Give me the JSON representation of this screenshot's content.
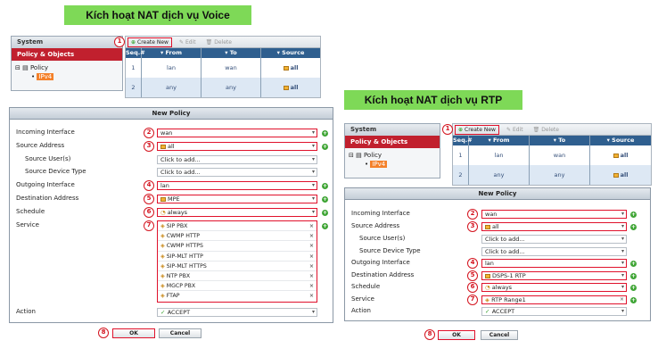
{
  "left": {
    "title": "Kích hoạt NAT dịch vụ Voice",
    "sidebar": {
      "header": "System",
      "active": "Policy & Objects",
      "tree_root": "Policy",
      "tree_child": "IPv4"
    },
    "toolbar": {
      "create": "Create New",
      "edit": "Edit",
      "delete": "Delete"
    },
    "grid": {
      "headers": [
        "Seq.#",
        "From",
        "To",
        "Source"
      ],
      "rows": [
        [
          "1",
          "lan",
          "wan",
          "all"
        ],
        [
          "2",
          "any",
          "any",
          "all"
        ]
      ]
    },
    "form": {
      "title": "New Policy",
      "labels": {
        "incoming": "Incoming Interface",
        "source": "Source Address",
        "users": "Source User(s)",
        "device": "Source Device Type",
        "outgoing": "Outgoing Interface",
        "destination": "Destination Address",
        "schedule": "Schedule",
        "service": "Service",
        "action": "Action"
      },
      "values": {
        "incoming": "wan",
        "source": "all",
        "users": "Click to add...",
        "device": "Click to add...",
        "outgoing": "lan",
        "destination": "MPE",
        "schedule": "always",
        "action": "ACCEPT"
      },
      "services": [
        "SIP PBX",
        "CWMP HTTP",
        "CWMP HTTPS",
        "SIP-MLT HTTP",
        "SIP-MLT HTTPS",
        "NTP PBX",
        "MGCP PBX",
        "FTAP"
      ],
      "ok": "OK",
      "cancel": "Cancel"
    }
  },
  "right": {
    "title": "Kích hoạt NAT dịch vụ RTP",
    "sidebar": {
      "header": "System",
      "active": "Policy & Objects",
      "tree_root": "Policy",
      "tree_child": "IPv4"
    },
    "toolbar": {
      "create": "Create New",
      "edit": "Edit",
      "delete": "Delete"
    },
    "grid": {
      "headers": [
        "Seq.#",
        "From",
        "To",
        "Source"
      ],
      "rows": [
        [
          "1",
          "lan",
          "wan",
          "all"
        ],
        [
          "2",
          "any",
          "any",
          "all"
        ]
      ]
    },
    "form": {
      "title": "New Policy",
      "labels": {
        "incoming": "Incoming Interface",
        "source": "Source Address",
        "users": "Source User(s)",
        "device": "Source Device Type",
        "outgoing": "Outgoing Interface",
        "destination": "Destination Address",
        "schedule": "Schedule",
        "service": "Service",
        "action": "Action"
      },
      "values": {
        "incoming": "wan",
        "source": "all",
        "users": "Click to add...",
        "device": "Click to add...",
        "outgoing": "lan",
        "destination": "DSPS-1 RTP",
        "schedule": "always",
        "service": "RTP Range1",
        "action": "ACCEPT"
      },
      "ok": "OK",
      "cancel": "Cancel"
    }
  },
  "steps": [
    "1",
    "2",
    "3",
    "4",
    "5",
    "6",
    "7",
    "8"
  ]
}
